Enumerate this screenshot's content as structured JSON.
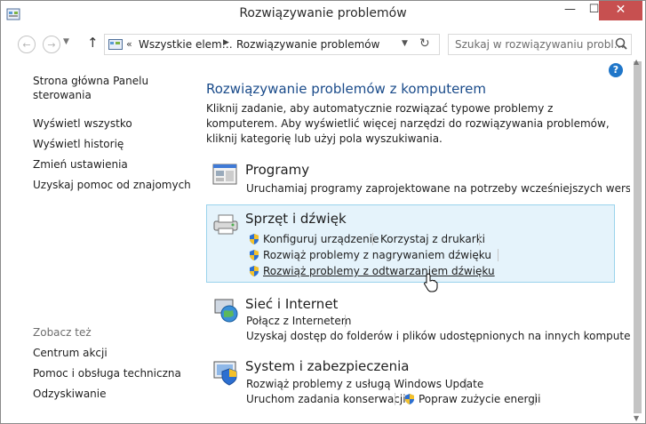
{
  "window": {
    "title": "Rozwiązywanie problemów"
  },
  "toolbar": {
    "recent_glyph": "▼",
    "up_glyph": "↑",
    "crumb_sep_lead": "«",
    "crumb_sep": "▶",
    "breadcrumbs": [
      "Wszystkie elem…",
      "Rozwiązywanie problemów"
    ],
    "search_placeholder": "Szukaj w rozwiązywaniu probl…"
  },
  "sidebar": {
    "items": [
      "Strona główna Panelu sterowania",
      "Wyświetl wszystko",
      "Wyświetl historię",
      "Zmień ustawienia",
      "Uzyskaj pomoc od znajomych"
    ],
    "see_also_label": "Zobacz też",
    "see_also": [
      "Centrum akcji",
      "Pomoc i obsługa techniczna",
      "Odzyskiwanie"
    ]
  },
  "main": {
    "heading": "Rozwiązywanie problemów z komputerem",
    "intro": "Kliknij zadanie, aby automatycznie rozwiązać typowe problemy z komputerem. Aby wyświetlić więcej narzędzi do rozwiązywania problemów, kliknij kategorię lub użyj pola wyszukiwania.",
    "categories": [
      {
        "title": "Programy",
        "tasks": [
          "Uruchamiaj programy zaprojektowane na potrzeby wcześniejszych wersji syste"
        ]
      },
      {
        "title": "Sprzęt i dźwięk",
        "tasks": [
          "Konfiguruj urządzenie",
          "Korzystaj z drukarki",
          "Rozwiąż problemy z nagrywaniem dźwięku",
          "Rozwiąż problemy z odtwarzaniem dźwięku"
        ]
      },
      {
        "title": "Sieć i Internet",
        "tasks": [
          "Połącz z Internetem",
          "Uzyskaj dostęp do folderów i plików udostępnionych na innych komputerach"
        ]
      },
      {
        "title": "System i zabezpieczenia",
        "tasks": [
          "Rozwiąż problemy z usługą Windows Update",
          "Uruchom zadania konserwacji",
          "Popraw zużycie energii"
        ]
      }
    ]
  },
  "colors": {
    "link": "#1a54b5",
    "category_title": "#1e7a1e",
    "heading": "#1a4b8a",
    "highlight_bg": "#e5f3fb",
    "highlight_border": "#9ad3ec",
    "close": "#c75050"
  }
}
